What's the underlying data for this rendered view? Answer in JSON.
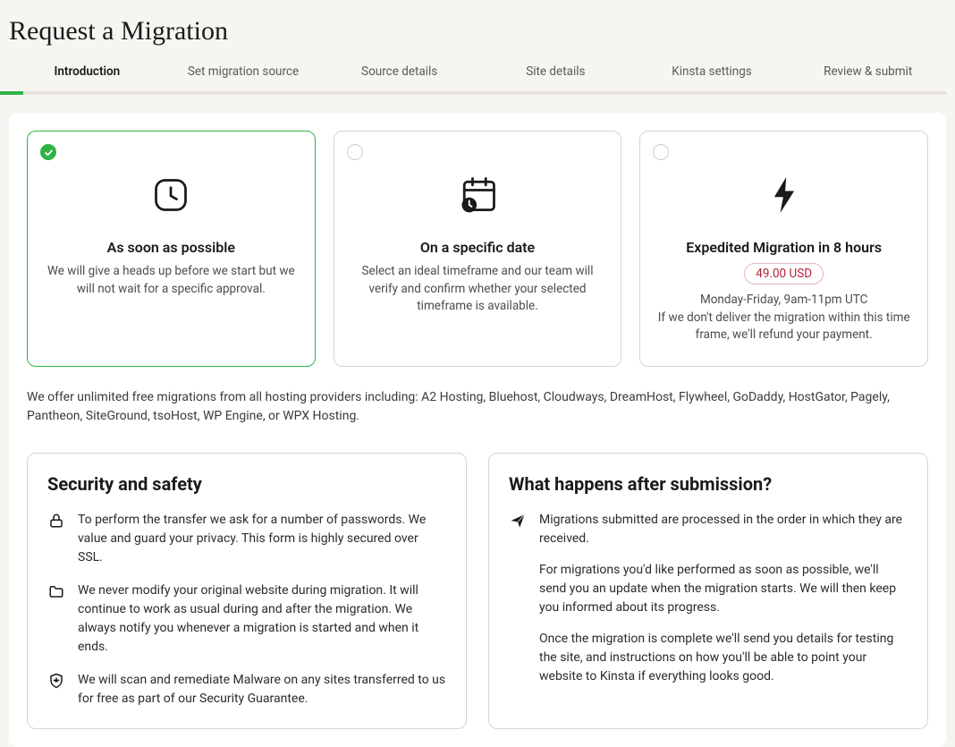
{
  "page": {
    "title": "Request a Migration"
  },
  "tabs": {
    "t0": "Introduction",
    "t1": "Set migration source",
    "t2": "Source details",
    "t3": "Site details",
    "t4": "Kinsta settings",
    "t5": "Review & submit"
  },
  "options": {
    "asap": {
      "title": "As soon as possible",
      "desc": "We will give a heads up before we start but we will not wait for a specific approval."
    },
    "specific": {
      "title": "On a specific date",
      "desc": "Select an ideal timeframe and our team will verify and confirm whether your selected timeframe is available."
    },
    "expedited": {
      "title": "Expedited Migration in 8 hours",
      "price": "49.00 USD",
      "line1": "Monday-Friday, 9am-11pm UTC",
      "line2": "If we don't deliver the migration within this time frame, we'll refund your payment."
    }
  },
  "providers": "We offer unlimited free migrations from all hosting providers including: A2 Hosting, Bluehost, Cloudways, DreamHost, Flywheel, GoDaddy, HostGator, Pagely, Pantheon, SiteGround, tsoHost, WP Engine, or WPX Hosting.",
  "security": {
    "title": "Security and safety",
    "item1": "To perform the transfer we ask for a number of passwords. We value and guard your privacy. This form is highly secured over SSL.",
    "item2": "We never modify your original website during migration. It will continue to work as usual during and after the migration. We always notify you whenever a migration is started and when it ends.",
    "item3": "We will scan and remediate Malware on any sites transferred to us for free as part of our Security Guarantee."
  },
  "after": {
    "title": "What happens after submission?",
    "p1": "Migrations submitted are processed in the order in which they are received.",
    "p2": "For migrations you'd like performed as soon as possible, we'll send you an update when the migration starts. We will then keep you informed about its progress.",
    "p3": "Once the migration is complete we'll send you details for testing the site, and instructions on how you'll be able to point your website to Kinsta if everything looks good."
  }
}
